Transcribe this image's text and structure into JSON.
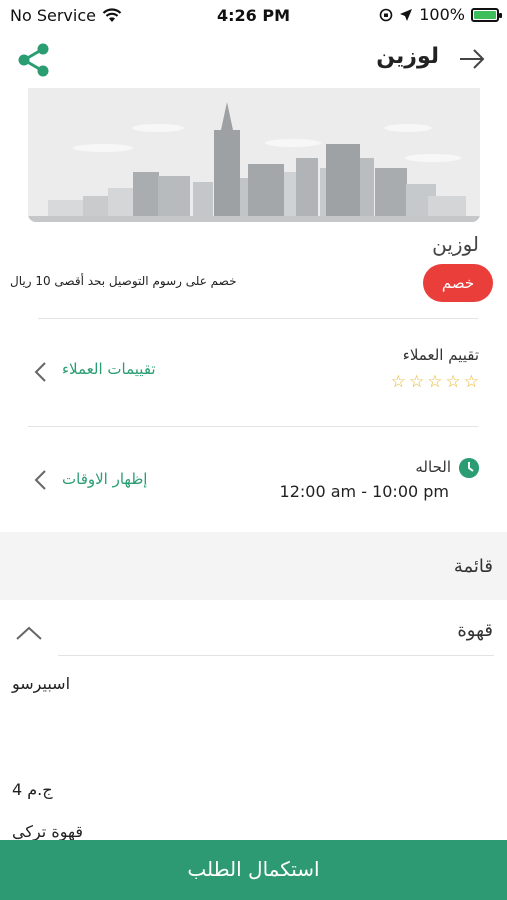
{
  "status_bar": {
    "carrier": "No Service",
    "time": "4:26 PM",
    "battery": "100%",
    "battery_level": 1.0
  },
  "nav": {
    "title": "لوزين",
    "share_icon": "share-icon",
    "back_icon": "arrow-right-icon"
  },
  "store": {
    "name": "لوزين",
    "discount_badge": "خصم",
    "discount_text": "خصم على رسوم التوصيل بحد أقصى 10 ريال"
  },
  "ratings": {
    "title": "تقييم العملاء",
    "link": "تقييمات العملاء",
    "stars_filled": 0,
    "stars_total": 5
  },
  "status": {
    "title": "الحاله",
    "hours": "12:00 am - 10:00 pm",
    "link": "إظهار الاوقات"
  },
  "menu": {
    "title": "قائمة",
    "category": "قهوة",
    "items": [
      {
        "name": "اسبيرسو"
      },
      {
        "price": "4 ج.م"
      },
      {
        "name": "قهوة تركي"
      }
    ]
  },
  "checkout": {
    "label": "استكمال الطلب"
  },
  "colors": {
    "accent": "#2e9a74",
    "badge": "#ea3e3a",
    "star": "#e7b52b"
  }
}
